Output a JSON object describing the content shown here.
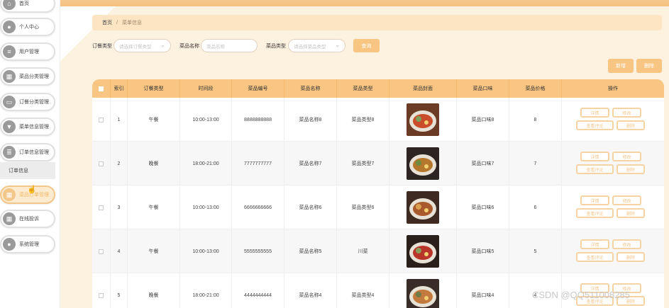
{
  "sidebar": {
    "items": [
      {
        "label": "首页",
        "icon": "home-icon"
      },
      {
        "label": "个人中心",
        "icon": "user-icon"
      },
      {
        "label": "用户管理",
        "icon": "users-icon"
      },
      {
        "label": "菜品分类管理",
        "icon": "grid-icon"
      },
      {
        "label": "订餐分类管理",
        "icon": "message-icon"
      },
      {
        "label": "菜单信息管理",
        "icon": "filter-icon"
      },
      {
        "label": "订单信息管理",
        "icon": "list-icon"
      },
      {
        "label": "菜品订单管理",
        "icon": "grid-icon"
      },
      {
        "label": "在线投诉",
        "icon": "grid-icon"
      },
      {
        "label": "系统管理",
        "icon": "user-icon"
      }
    ],
    "submenu": {
      "label": "订单信息"
    }
  },
  "breadcrumb": {
    "home": "首页",
    "separator": "/",
    "current": "菜单信息"
  },
  "filters": {
    "order_type_label": "订餐类型",
    "order_type_placeholder": "请选择订餐类型",
    "dish_name_label": "菜品名称",
    "dish_name_placeholder": "菜品名称",
    "dish_type_label": "菜品类型",
    "dish_type_placeholder": "请选择菜品类型",
    "search_button": "查询"
  },
  "actions": {
    "add_button": "新增",
    "delete_button": "删除"
  },
  "table": {
    "headers": [
      "索引",
      "订餐类型",
      "时间段",
      "菜品编号",
      "菜品名称",
      "菜品类型",
      "菜品封面",
      "菜品口味",
      "菜品价格",
      "操作"
    ],
    "rows": [
      {
        "index": "1",
        "order_type": "午餐",
        "time": "10:00-13:00",
        "code": "8888888888",
        "name": "菜品名称8",
        "type": "菜品类型8",
        "taste": "菜品口味8",
        "price": "8"
      },
      {
        "index": "2",
        "order_type": "晚餐",
        "time": "18:00-21:00",
        "code": "7777777777",
        "name": "菜品名称7",
        "type": "菜品类型7",
        "taste": "菜品口味7",
        "price": "7"
      },
      {
        "index": "3",
        "order_type": "午餐",
        "time": "10:00-13:00",
        "code": "6666666666",
        "name": "菜品名称6",
        "type": "菜品类型6",
        "taste": "菜品口味6",
        "price": "6"
      },
      {
        "index": "4",
        "order_type": "午餐",
        "time": "10:00-13:00",
        "code": "5555555555",
        "name": "菜品名称5",
        "type": "川菜",
        "taste": "菜品口味5",
        "price": "5"
      },
      {
        "index": "5",
        "order_type": "晚餐",
        "time": "18:00-21:00",
        "code": "4444444444",
        "name": "菜品名称4",
        "type": "菜品类型4",
        "taste": "菜品口味4",
        "price": "4"
      }
    ],
    "op_labels": {
      "detail": "详情",
      "edit": "修改",
      "comments": "查看评论",
      "delete": "删除"
    }
  },
  "watermark": "CSDN @QQ511008285",
  "colors": {
    "accent": "#f8c583",
    "topbar": "#f6c98c",
    "breadcrumb_bg": "#fde5c3"
  }
}
